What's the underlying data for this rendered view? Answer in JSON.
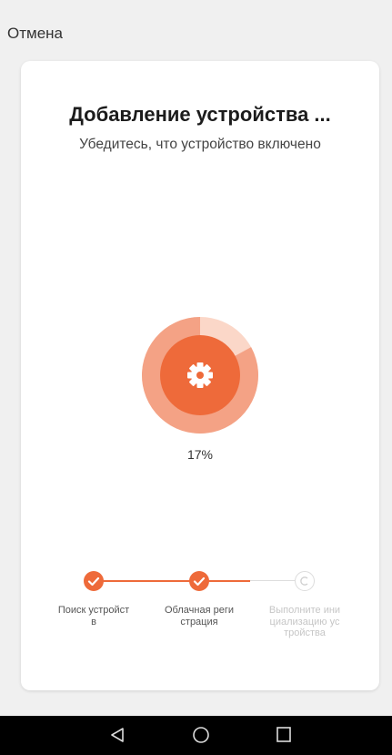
{
  "header": {
    "cancel_label": "Отмена"
  },
  "card": {
    "title": "Добавление устройства ...",
    "subtitle": "Убедитесь, что устройство включено"
  },
  "progress": {
    "percent_text": "17%",
    "value": 0.17,
    "icon": "gear-icon"
  },
  "steps": [
    {
      "label": "Поиск устройств",
      "status": "done"
    },
    {
      "label": "Облачная регистрация",
      "status": "done"
    },
    {
      "label": "Выполните инициализацию устройства",
      "status": "pending"
    }
  ],
  "colors": {
    "accent": "#ee6a3a",
    "accent_light": "#f7b59c",
    "accent_faint": "#fbd7c8",
    "pending": "#c6c6c6"
  },
  "navbar": {
    "icons": [
      "back-icon",
      "home-icon",
      "recents-icon"
    ]
  }
}
